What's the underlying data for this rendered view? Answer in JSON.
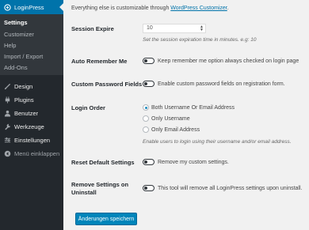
{
  "sidebar": {
    "active": {
      "label": "LoginPress"
    },
    "submenu": [
      {
        "label": "Settings"
      },
      {
        "label": "Customizer"
      },
      {
        "label": "Help"
      },
      {
        "label": "Import / Export"
      },
      {
        "label": "Add-Ons"
      }
    ],
    "items": [
      {
        "label": "Design",
        "icon": "brush-icon"
      },
      {
        "label": "Plugins",
        "icon": "plugin-icon"
      },
      {
        "label": "Benutzer",
        "icon": "user-icon"
      },
      {
        "label": "Werkzeuge",
        "icon": "wrench-icon"
      },
      {
        "label": "Einstellungen",
        "icon": "settings-icon"
      },
      {
        "label": "Menü einklappen",
        "icon": "collapse-icon"
      }
    ]
  },
  "main": {
    "intro_text": "Everything else is customizable through",
    "intro_link": "WordPress Customizer",
    "intro_end": ".",
    "session_expire": {
      "label": "Session Expire",
      "value": "10",
      "description": "Set the session expiration time in minutes. e.g: 10"
    },
    "auto_remember": {
      "label": "Auto Remember Me",
      "text": "Keep remember me option always checked on login page"
    },
    "custom_password": {
      "label": "Custom Password Fields",
      "text": "Enable custom password fields on registration form."
    },
    "login_order": {
      "label": "Login Order",
      "options": [
        {
          "label": "Both Username Or Email Address",
          "checked": true
        },
        {
          "label": "Only Username",
          "checked": false
        },
        {
          "label": "Only Email Address",
          "checked": false
        }
      ],
      "description": "Enable users to login using their username and/or email address."
    },
    "reset_default": {
      "label": "Reset Default Settings",
      "text": "Remove my custom settings."
    },
    "remove_uninstall": {
      "label_line1": "Remove Settings on",
      "label_line2": "Uninstall",
      "text": "This tool will remove all LoginPress settings upon uninstall."
    },
    "save_button": "Änderungen speichern"
  },
  "colors": {
    "accent": "#0073aa",
    "sidebar": "#23282d",
    "submenu": "#32373c"
  }
}
